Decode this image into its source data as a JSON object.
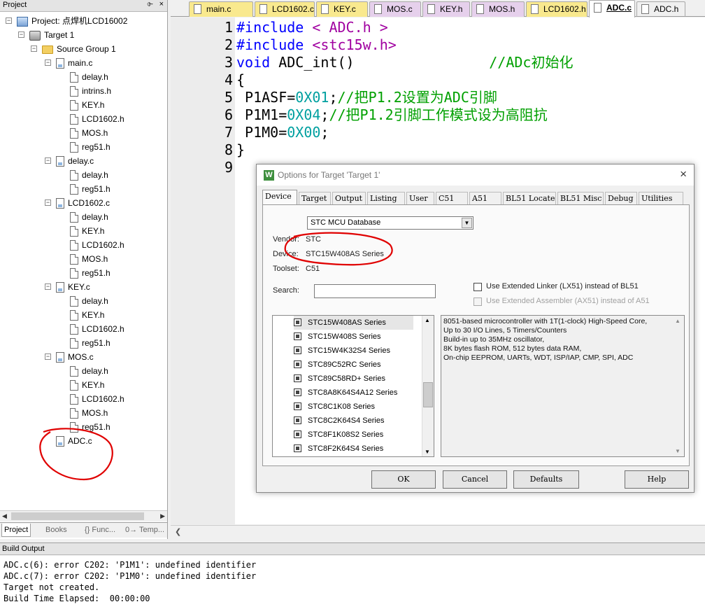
{
  "project_panel": {
    "title": "Project",
    "pin_glyph": "⌱",
    "close_glyph": "×",
    "tree": {
      "project": "Project: 点焊机LCD16002",
      "target": "Target 1",
      "group": "Source Group 1",
      "files": [
        {
          "name": "main.c",
          "children": [
            "delay.h",
            "intrins.h",
            "KEY.h",
            "LCD1602.h",
            "MOS.h",
            "reg51.h"
          ]
        },
        {
          "name": "delay.c",
          "children": [
            "delay.h",
            "reg51.h"
          ]
        },
        {
          "name": "LCD1602.c",
          "children": [
            "delay.h",
            "KEY.h",
            "LCD1602.h",
            "MOS.h",
            "reg51.h"
          ]
        },
        {
          "name": "KEY.c",
          "children": [
            "delay.h",
            "KEY.h",
            "LCD1602.h",
            "reg51.h"
          ]
        },
        {
          "name": "MOS.c",
          "children": [
            "delay.h",
            "KEY.h",
            "LCD1602.h",
            "MOS.h",
            "reg51.h"
          ]
        },
        {
          "name": "ADC.c",
          "children": []
        }
      ]
    },
    "tabs": [
      "Project",
      "Books",
      "{} Func...",
      "0→ Temp..."
    ]
  },
  "editor": {
    "tabs": [
      {
        "label": "main.c",
        "kind": "c"
      },
      {
        "label": "LCD1602.c",
        "kind": "c"
      },
      {
        "label": "KEY.c",
        "kind": "c"
      },
      {
        "label": "MOS.c",
        "kind": "h"
      },
      {
        "label": "KEY.h",
        "kind": "h"
      },
      {
        "label": "MOS.h",
        "kind": "h"
      },
      {
        "label": "LCD1602.h",
        "kind": "c"
      },
      {
        "label": "ADC.c",
        "kind": "active"
      },
      {
        "label": "ADC.h",
        "kind": "plain"
      }
    ],
    "lines": [
      {
        "n": "1",
        "parts": [
          [
            "kw",
            "#include"
          ],
          [
            "st",
            " < ADC.h >"
          ]
        ]
      },
      {
        "n": "2",
        "parts": [
          [
            "kw",
            "#include"
          ],
          [
            "st",
            " <stc15w.h>"
          ]
        ]
      },
      {
        "n": "3",
        "parts": [
          [
            "kw",
            "void"
          ],
          [
            "",
            " ADC_int()"
          ],
          [
            "cm",
            "                //ADc初始化"
          ]
        ]
      },
      {
        "n": "4",
        "parts": [
          [
            "",
            "{"
          ]
        ]
      },
      {
        "n": "5",
        "parts": [
          [
            "",
            " P1ASF="
          ],
          [
            "nm",
            "0X01"
          ],
          [
            "",
            ";"
          ],
          [
            "cm",
            "//把P1.2设置为ADC引脚"
          ]
        ]
      },
      {
        "n": "6",
        "parts": [
          [
            "",
            " P1M1="
          ],
          [
            "nm",
            "0X04"
          ],
          [
            "",
            ";"
          ],
          [
            "cm",
            "//把P1.2引脚工作模式设为高阻抗"
          ]
        ]
      },
      {
        "n": "7",
        "parts": [
          [
            "",
            " P1M0="
          ],
          [
            "nm",
            "0X00"
          ],
          [
            "",
            ";"
          ]
        ]
      },
      {
        "n": "8",
        "parts": [
          [
            "",
            "}"
          ]
        ]
      },
      {
        "n": "9",
        "parts": []
      }
    ]
  },
  "dialog": {
    "title": "Options for Target 'Target 1'",
    "icon_glyph": "W",
    "close_glyph": "×",
    "tabs": [
      "Device",
      "Target",
      "Output",
      "Listing",
      "User",
      "C51",
      "A51",
      "BL51 Locate",
      "BL51 Misc",
      "Debug",
      "Utilities"
    ],
    "database": "STC MCU Database",
    "vendor_label": "Vendor:",
    "vendor_value": "STC",
    "device_label": "Device:",
    "device_value": "STC15W408AS Series",
    "toolset_label": "Toolset:",
    "toolset_value": "C51",
    "search_label": "Search:",
    "search_value": "",
    "use_lx51": "Use Extended Linker (LX51) instead of BL51",
    "use_ax51": "Use Extended Assembler (AX51) instead of A51",
    "devices": [
      "STC15W408AS Series",
      "STC15W408S Series",
      "STC15W4K32S4 Series",
      "STC89C52RC Series",
      "STC89C58RD+ Series",
      "STC8A8K64S4A12 Series",
      "STC8C1K08 Series",
      "STC8C2K64S4 Series",
      "STC8F1K08S2 Series",
      "STC8F2K64S4 Series"
    ],
    "selected_device": "STC15W408AS Series",
    "description": [
      "8051-based microcontroller with 1T(1-clock) High-Speed Core,",
      "Up to 30 I/O Lines, 5 Timers/Counters",
      "Build-in up to 35MHz oscillator,",
      "8K bytes flash ROM, 512 bytes data RAM,",
      "On-chip EEPROM, UARTs, WDT, ISP/IAP, CMP, SPI, ADC"
    ],
    "buttons": {
      "ok": "OK",
      "cancel": "Cancel",
      "defaults": "Defaults",
      "help": "Help"
    }
  },
  "build_output": {
    "title": "Build Output",
    "lines": [
      "ADC.c(6): error C202: 'P1M1': undefined identifier",
      "ADC.c(7): error C202: 'P1M0': undefined identifier",
      "Target not created.",
      "Build Time Elapsed:  00:00:00"
    ]
  },
  "colors": {
    "annotation_red": "#e00000",
    "code_keyword": "#0000ff",
    "code_string": "#a000a0",
    "code_number": "#00a0a0",
    "code_comment": "#00a000"
  }
}
